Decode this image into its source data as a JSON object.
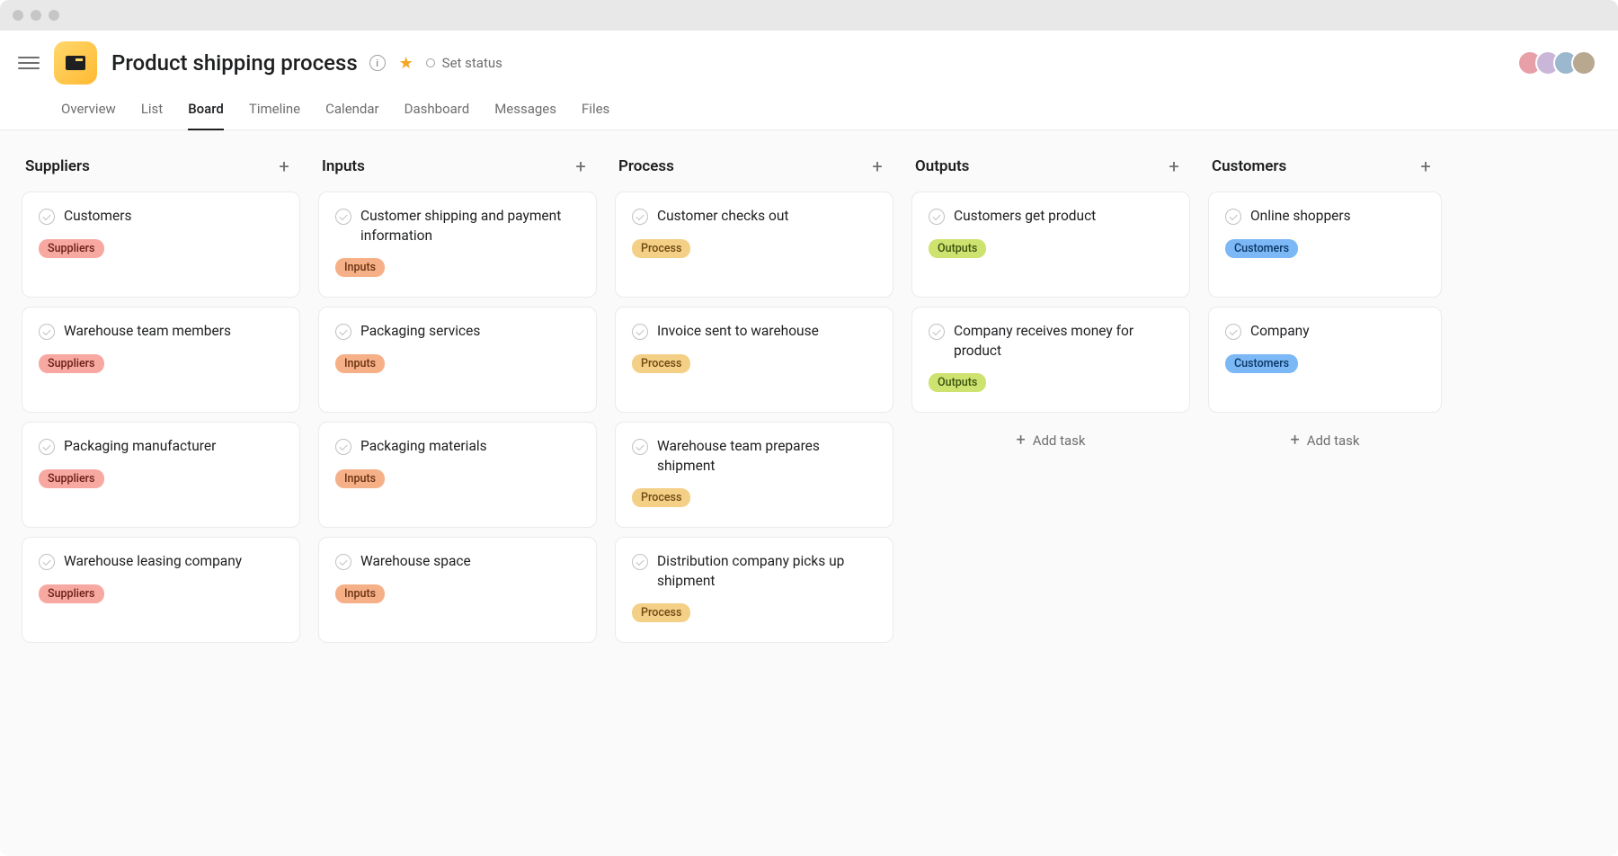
{
  "project": {
    "title": "Product shipping process",
    "status_label": "Set status"
  },
  "tabs": [
    {
      "label": "Overview"
    },
    {
      "label": "List"
    },
    {
      "label": "Board",
      "active": true
    },
    {
      "label": "Timeline"
    },
    {
      "label": "Calendar"
    },
    {
      "label": "Dashboard"
    },
    {
      "label": "Messages"
    },
    {
      "label": "Files"
    }
  ],
  "add_task_label": "Add task",
  "columns": [
    {
      "title": "Suppliers",
      "tag_class": "tag-suppliers",
      "tag_label": "Suppliers",
      "cards": [
        {
          "title": "Customers"
        },
        {
          "title": "Warehouse team members"
        },
        {
          "title": "Packaging manufacturer"
        },
        {
          "title": "Warehouse leasing company"
        }
      ]
    },
    {
      "title": "Inputs",
      "tag_class": "tag-inputs",
      "tag_label": "Inputs",
      "cards": [
        {
          "title": "Customer shipping and payment information"
        },
        {
          "title": "Packaging services"
        },
        {
          "title": "Packaging materials"
        },
        {
          "title": "Warehouse space"
        }
      ]
    },
    {
      "title": "Process",
      "tag_class": "tag-process",
      "tag_label": "Process",
      "cards": [
        {
          "title": "Customer checks out"
        },
        {
          "title": "Invoice sent to warehouse"
        },
        {
          "title": "Warehouse team prepares shipment"
        },
        {
          "title": "Distribution company picks up shipment"
        }
      ]
    },
    {
      "title": "Outputs",
      "tag_class": "tag-outputs",
      "tag_label": "Outputs",
      "cards": [
        {
          "title": "Customers get product"
        },
        {
          "title": "Company receives money for product"
        }
      ],
      "show_add_task": true
    },
    {
      "title": "Customers",
      "tag_class": "tag-customers",
      "tag_label": "Customers",
      "cards": [
        {
          "title": "Online shoppers"
        },
        {
          "title": "Company"
        }
      ],
      "show_add_task": true
    }
  ]
}
